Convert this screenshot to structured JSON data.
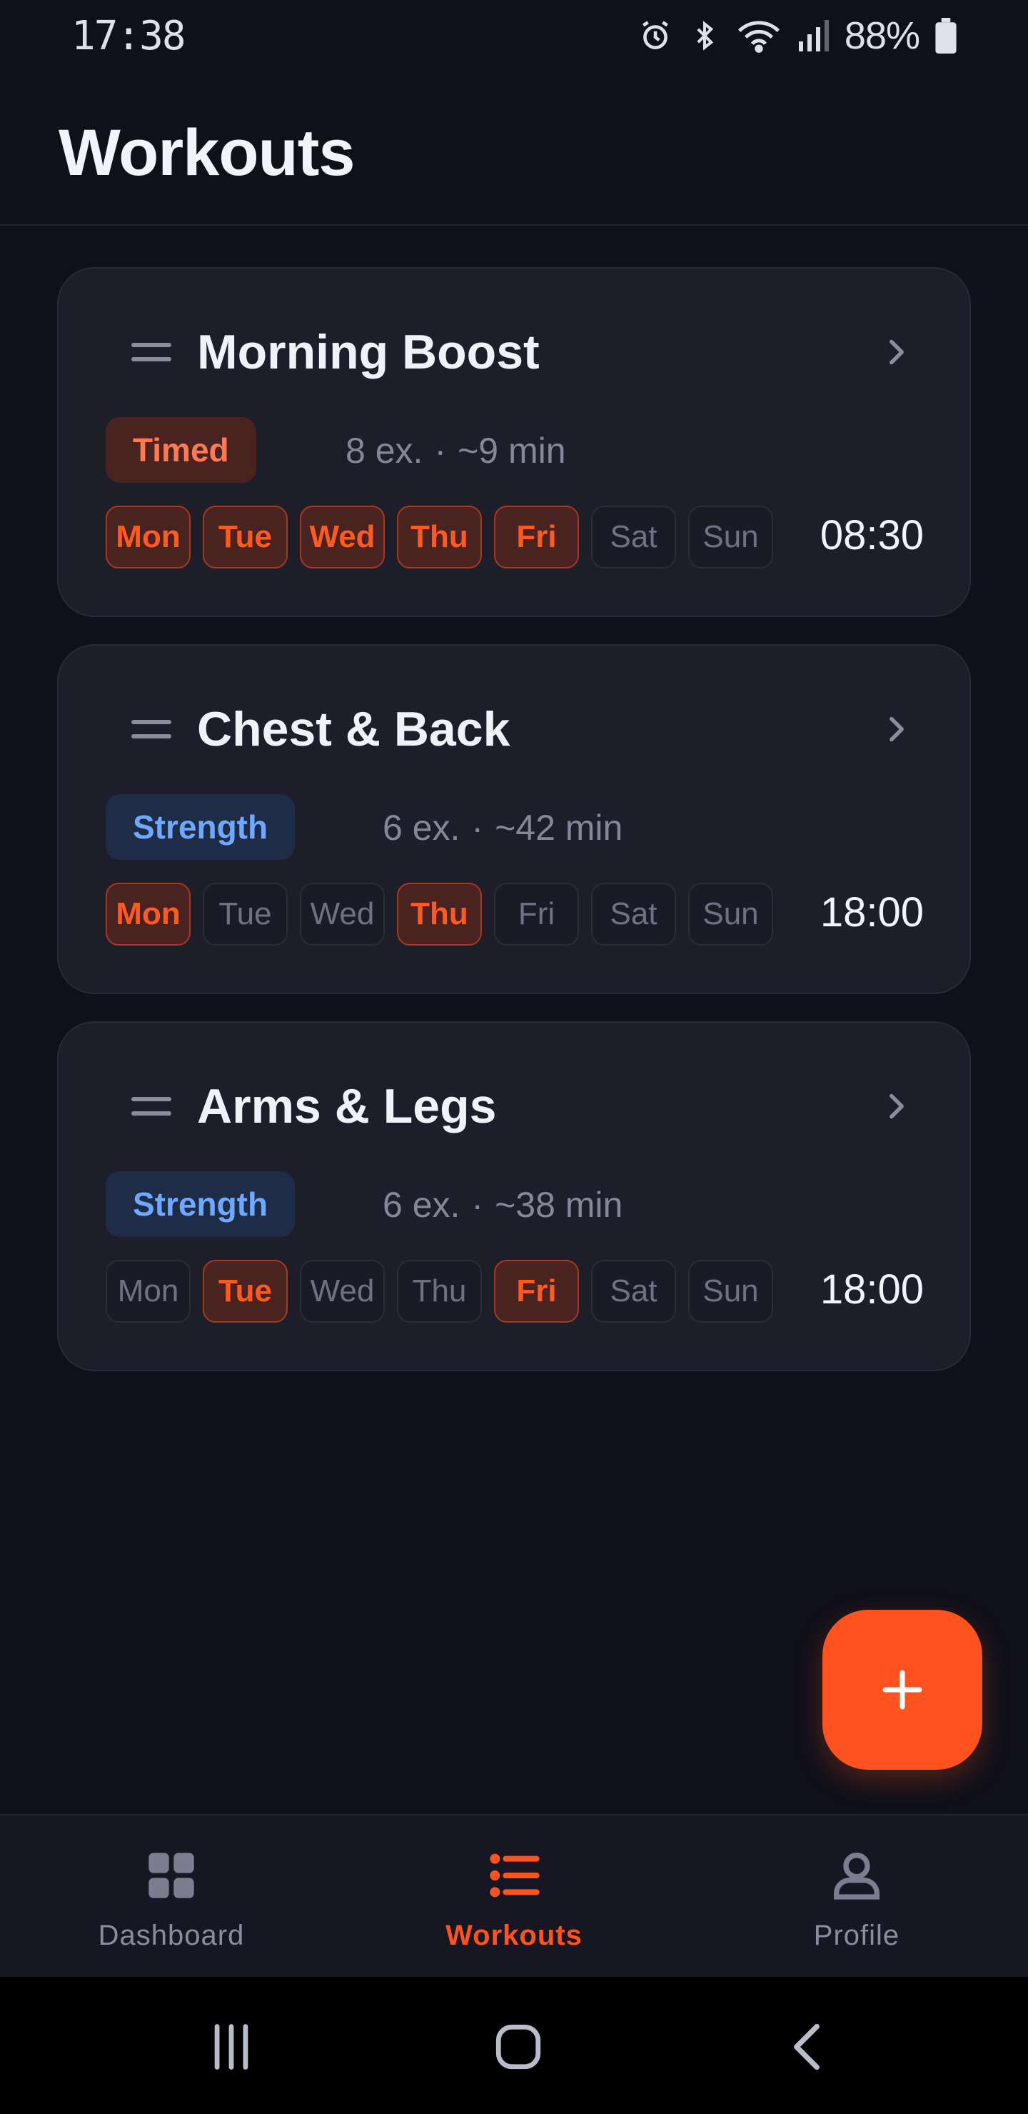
{
  "status_bar": {
    "time": "17:38",
    "battery": "88%",
    "icons": [
      "alarm-icon",
      "bluetooth-icon",
      "wifi-icon",
      "signal-icon",
      "battery-icon"
    ]
  },
  "header": {
    "title": "Workouts"
  },
  "workouts": [
    {
      "name": "Morning Boost",
      "type": "Timed",
      "exercises": "8 ex.",
      "separator": "·",
      "duration": "~9 min",
      "days": [
        "Mon",
        "Tue",
        "Wed",
        "Thu",
        "Fri",
        "Sat",
        "Sun"
      ],
      "active_days": [
        "Mon",
        "Tue",
        "Wed",
        "Thu",
        "Fri"
      ],
      "time": "08:30"
    },
    {
      "name": "Chest & Back",
      "type": "Strength",
      "exercises": "6 ex.",
      "separator": "·",
      "duration": "~42 min",
      "days": [
        "Mon",
        "Tue",
        "Wed",
        "Thu",
        "Fri",
        "Sat",
        "Sun"
      ],
      "active_days": [
        "Mon",
        "Thu"
      ],
      "time": "18:00"
    },
    {
      "name": "Arms & Legs",
      "type": "Strength",
      "exercises": "6 ex.",
      "separator": "·",
      "duration": "~38 min",
      "days": [
        "Mon",
        "Tue",
        "Wed",
        "Thu",
        "Fri",
        "Sat",
        "Sun"
      ],
      "active_days": [
        "Tue",
        "Fri"
      ],
      "time": "18:00"
    }
  ],
  "fab": {
    "icon": "plus-icon"
  },
  "bottom_nav": [
    {
      "label": "Dashboard",
      "icon": "grid-icon",
      "active": false
    },
    {
      "label": "Workouts",
      "icon": "list-icon",
      "active": true
    },
    {
      "label": "Profile",
      "icon": "person-icon",
      "active": false
    }
  ],
  "colors": {
    "accent": "#ff531f",
    "background": "#0f1019",
    "card": "#1d1e2a",
    "timed_badge_text": "#ff7a52",
    "strength_badge_text": "#6fa8ff",
    "muted_text": "#858899"
  }
}
